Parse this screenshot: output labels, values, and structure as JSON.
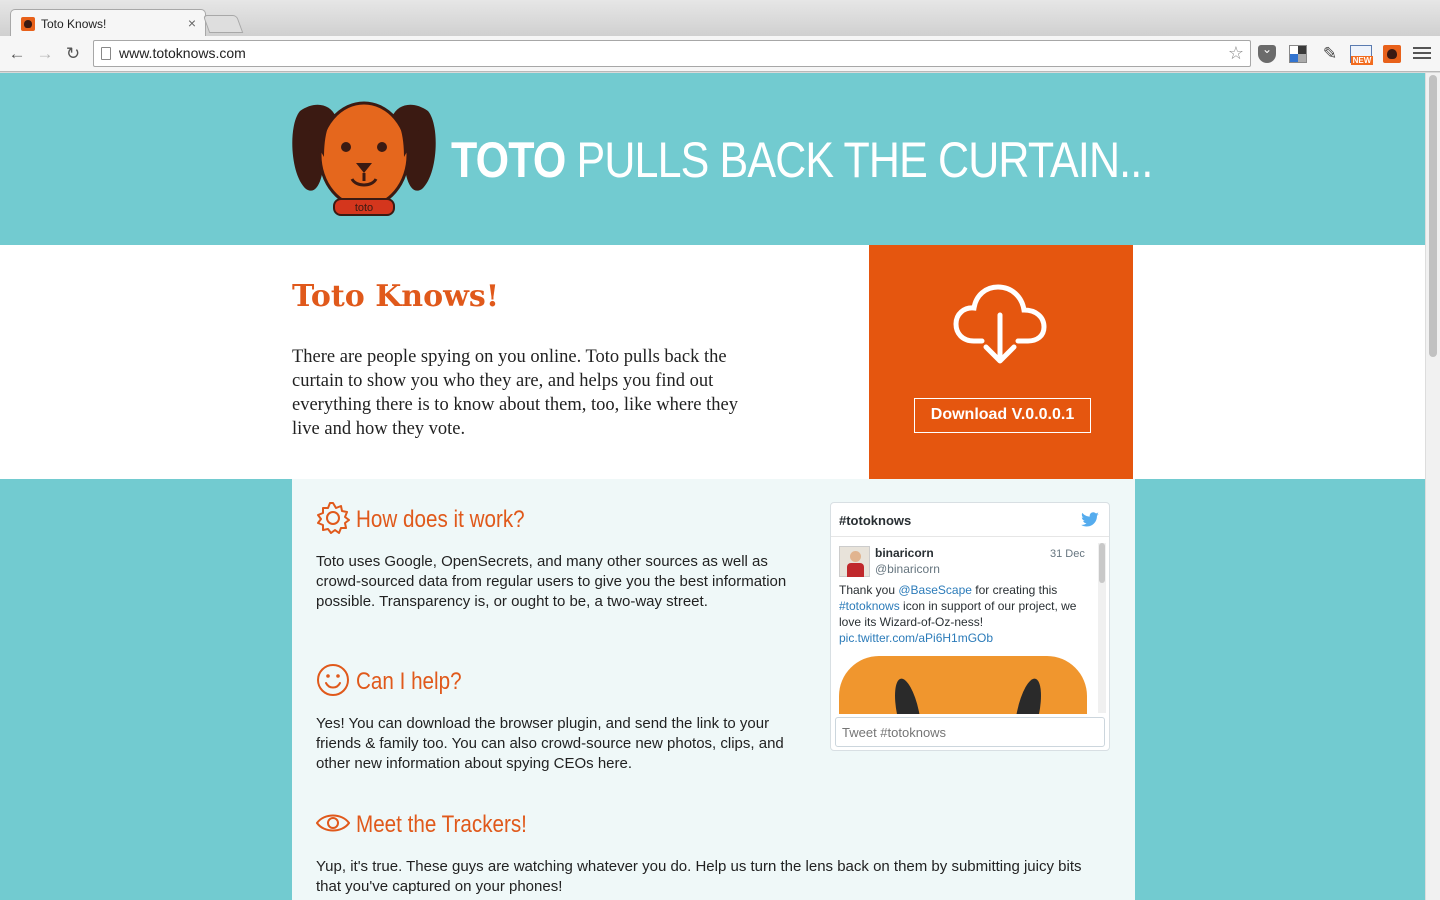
{
  "browser": {
    "tab_title": "Toto Knows!",
    "tab_close": "×",
    "url": "www.totoknows.com",
    "nav": {
      "back": "←",
      "forward": "→",
      "reload": "↻"
    },
    "star": "☆",
    "extensions": [
      "pocket-icon",
      "delicious-icon",
      "eyedropper-icon",
      "feed-new-icon",
      "toto-icon"
    ],
    "ext_new_badge": "NEW"
  },
  "header": {
    "logo_collar": "toto",
    "headline_strong": "TOTO",
    "headline_rest": " PULLS BACK THE CURTAIN..."
  },
  "intro": {
    "title": "Toto Knows!",
    "body": "There are people spying on you online. Toto pulls back the curtain to show you who they are, and helps you find out everything there is to know about them, too, like where they live and how they vote.",
    "download_label": "Download V.0.0.0.1"
  },
  "sections": [
    {
      "title": "How does it work?",
      "icon": "gear-icon",
      "text": "Toto uses Google, OpenSecrets, and many other sources as well as crowd-sourced data from regular users to give you the best information possible. Transparency is, or ought to be, a two-way street."
    },
    {
      "title": "Can I help?",
      "icon": "smiley-icon",
      "text": "Yes! You can download the browser plugin, and send the link to your friends & family too. You can also crowd-source new photos, clips, and other new information about spying CEOs here."
    },
    {
      "title": "Meet the Trackers!",
      "icon": "eye-icon",
      "text": "Yup, it's true. These guys are watching whatever you do. Help us turn the lens back on them by submitting juicy bits that you've captured on your phones!"
    }
  ],
  "twitter": {
    "hashtag": "#totoknows",
    "tweet": {
      "name": "binaricorn",
      "handle": "@binaricorn",
      "date": "31 Dec",
      "text_1": "Thank you ",
      "mention": "@BaseScape",
      "text_2": " for creating this ",
      "hashtag": "#totoknows",
      "text_3": " icon in support of our project, we love its Wizard-of-Oz-ness! ",
      "link": "pic.twitter.com/aPi6H1mGOb"
    },
    "input_placeholder": "Tweet #totoknows"
  },
  "colors": {
    "teal": "#72cbd0",
    "orange": "#e5560f",
    "title_orange": "#e0591b"
  }
}
